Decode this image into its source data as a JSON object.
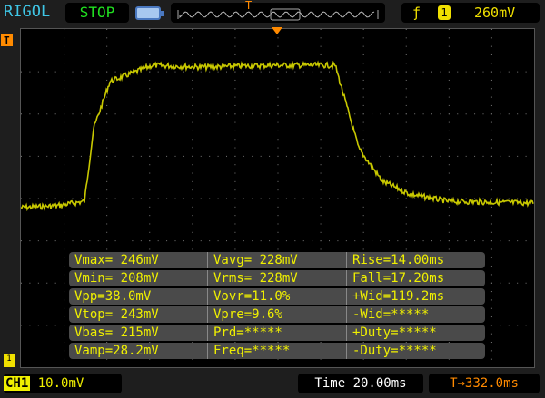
{
  "header": {
    "brand": "RIGOL",
    "run_state": "STOP",
    "trigger_marker": "T",
    "trigger_channel": "1",
    "trigger_level": "260mV",
    "trigger_slope_icon": "rising-edge-icon"
  },
  "screen": {
    "trigger_tag": "T",
    "channel_marker": "1"
  },
  "measurements": [
    [
      "Vmax= 246mV",
      "Vavg= 228mV",
      "Rise=14.00ms"
    ],
    [
      "Vmin= 208mV",
      "Vrms= 228mV",
      "Fall=17.20ms"
    ],
    [
      "Vpp=38.0mV",
      "Vovr=11.0%",
      "+Wid=119.2ms"
    ],
    [
      "Vtop= 243mV",
      "Vpre=9.6%",
      "-Wid=*****"
    ],
    [
      "Vbas= 215mV",
      "Prd=*****",
      "+Duty=*****"
    ],
    [
      "Vamp=28.2mV",
      "Freq=*****",
      "-Duty=*****"
    ]
  ],
  "footer": {
    "channel": "CH1",
    "volts_div": "10.0mV",
    "timebase": "Time 20.00ms",
    "trigger_offset": "332.0ms"
  },
  "colors": {
    "trace": "#c8c800",
    "accent": "#ff8a00"
  }
}
